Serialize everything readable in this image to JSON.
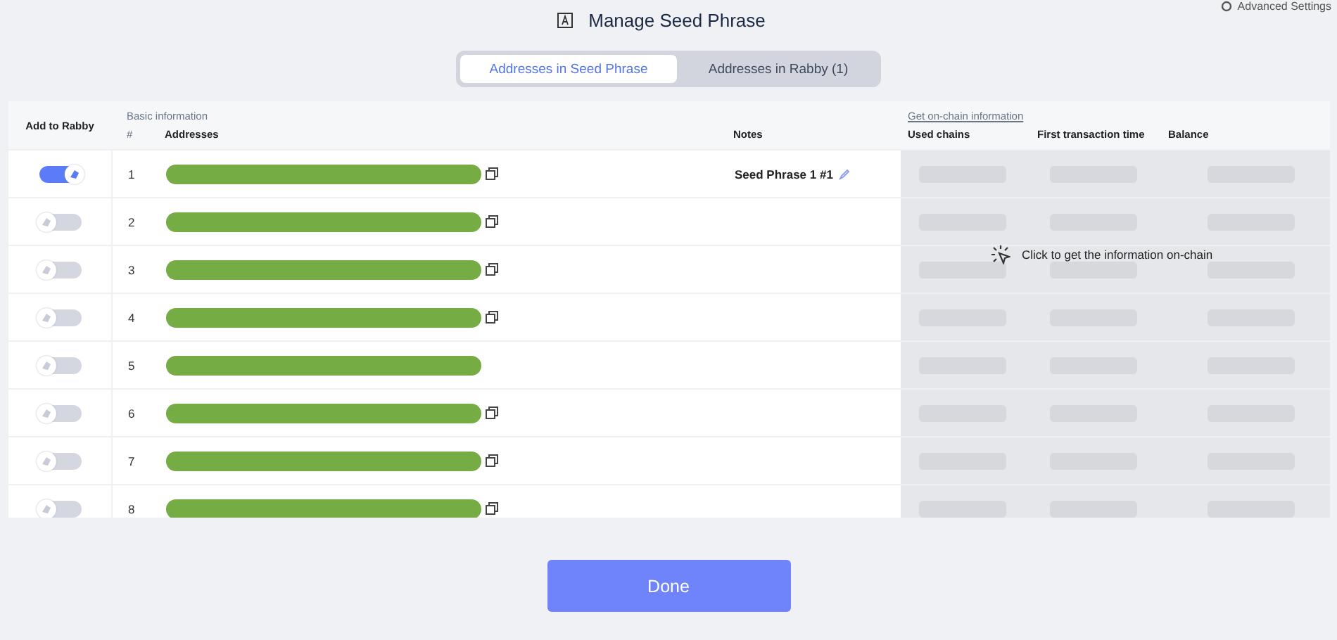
{
  "window": {
    "title": "Manage Seed Phrase"
  },
  "advanced_settings": "Advanced Settings",
  "tabs": [
    {
      "label": "Addresses in Seed Phrase",
      "selected": true
    },
    {
      "label": "Addresses in Rabby (1)",
      "selected": false
    }
  ],
  "table": {
    "add_column": "Add to Rabby",
    "basic_group": "Basic information",
    "onchain_link": "Get on-chain information",
    "columns": [
      "#",
      "Addresses",
      "Notes",
      "Used chains",
      "First transaction time",
      "Balance"
    ],
    "rows": [
      {
        "index": "1",
        "added": true,
        "note": "Seed Phrase 1 #1",
        "copy_icon": true
      },
      {
        "index": "2",
        "added": false,
        "copy_icon": true
      },
      {
        "index": "3",
        "added": false,
        "copy_icon": true
      },
      {
        "index": "4",
        "added": false,
        "copy_icon": true
      },
      {
        "index": "5",
        "added": false,
        "copy_icon": false
      },
      {
        "index": "6",
        "added": false,
        "copy_icon": true
      },
      {
        "index": "7",
        "added": false,
        "copy_icon": true
      },
      {
        "index": "8",
        "added": false,
        "copy_icon": true
      }
    ],
    "onchain_hint": "Click to get the information on-chain"
  },
  "done_button": "Done"
}
